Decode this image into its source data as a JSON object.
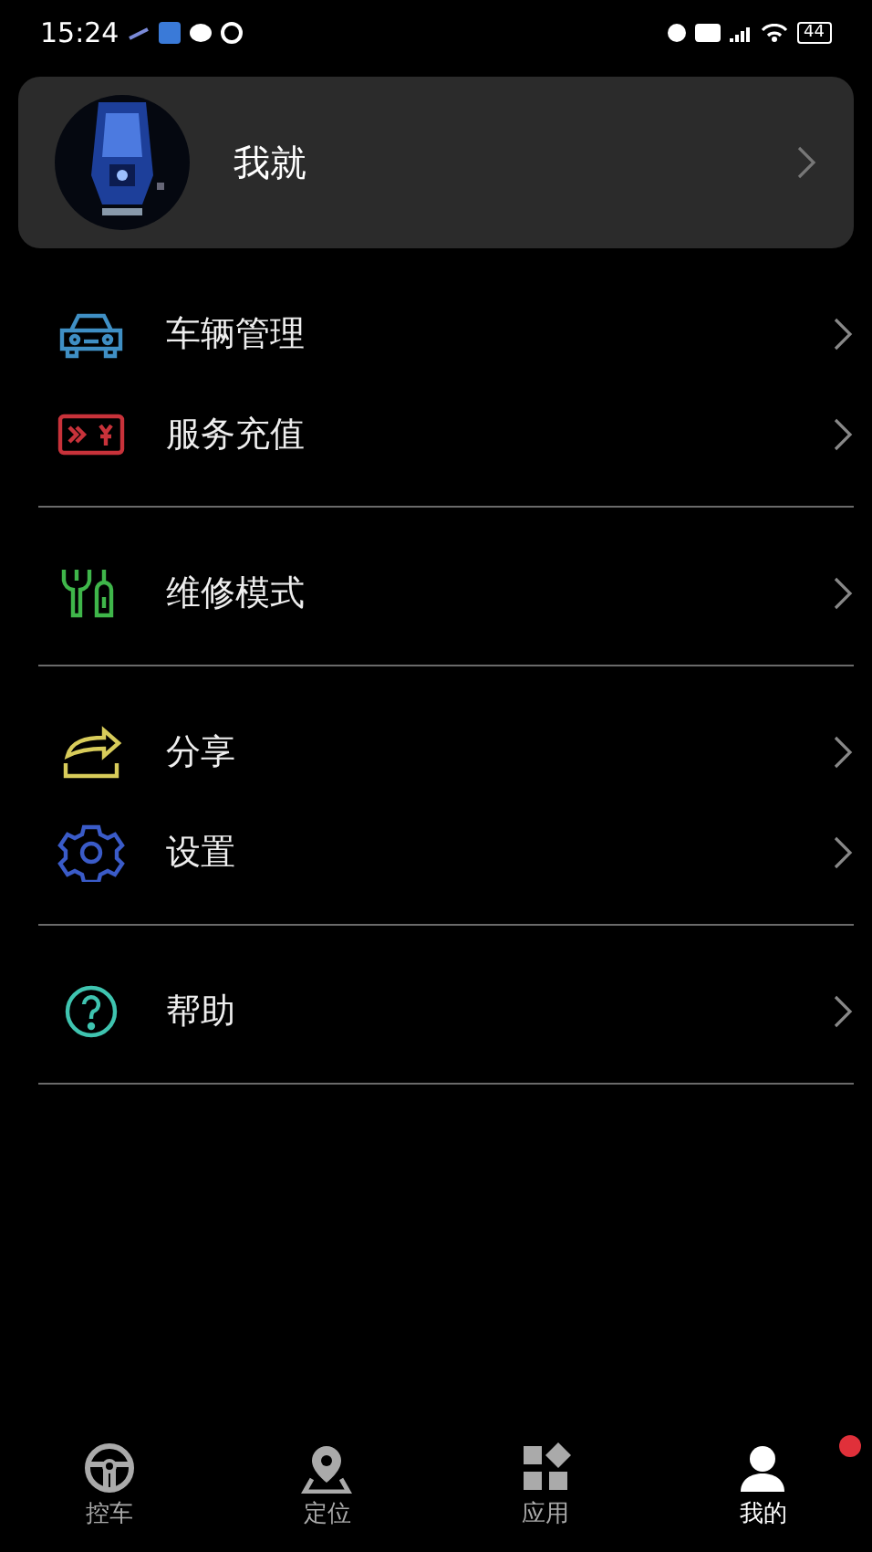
{
  "status_bar": {
    "time": "15:24",
    "battery": "44"
  },
  "profile": {
    "name": "我就"
  },
  "menu_groups": [
    {
      "items": [
        {
          "label": "车辆管理",
          "color": "#3f8fc4"
        },
        {
          "label": "服务充值",
          "color": "#c8323a"
        }
      ]
    },
    {
      "items": [
        {
          "label": "维修模式",
          "color": "#3fb64a"
        }
      ]
    },
    {
      "items": [
        {
          "label": "分享",
          "color": "#d8cc5a"
        },
        {
          "label": "设置",
          "color": "#3a5bc8"
        }
      ]
    },
    {
      "items": [
        {
          "label": "帮助",
          "color": "#3fc4b0"
        }
      ]
    }
  ],
  "tab_bar": [
    {
      "label": "控车",
      "selected": false,
      "badge": false
    },
    {
      "label": "定位",
      "selected": false,
      "badge": false
    },
    {
      "label": "应用",
      "selected": false,
      "badge": false
    },
    {
      "label": "我的",
      "selected": true,
      "badge": true
    }
  ]
}
